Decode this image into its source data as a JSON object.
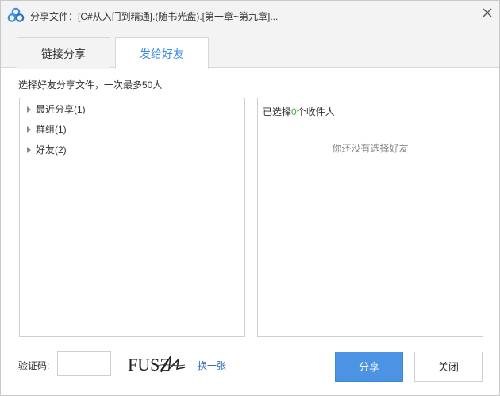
{
  "window": {
    "title": "分享文件：[C#从入门到精通].(随书光盘).[第一章~第九章]..."
  },
  "tabs": [
    {
      "label": "链接分享",
      "active": false
    },
    {
      "label": "发给好友",
      "active": true
    }
  ],
  "hint": "选择好友分享文件，一次最多50人",
  "tree": [
    {
      "label": "最近分享(1)"
    },
    {
      "label": "群组(1)"
    },
    {
      "label": "好友(2)"
    }
  ],
  "selection": {
    "prefix": "已选择",
    "count": "0",
    "suffix": "个收件人",
    "empty": "你还没有选择好友"
  },
  "captcha": {
    "label": "验证码:",
    "value": "",
    "image_text": "FUSZ",
    "refresh": "换一张"
  },
  "buttons": {
    "share": "分享",
    "close": "关闭"
  },
  "colors": {
    "accent": "#3b8de2",
    "primary_button": "#4c93e3",
    "count": "#3cb43c"
  }
}
